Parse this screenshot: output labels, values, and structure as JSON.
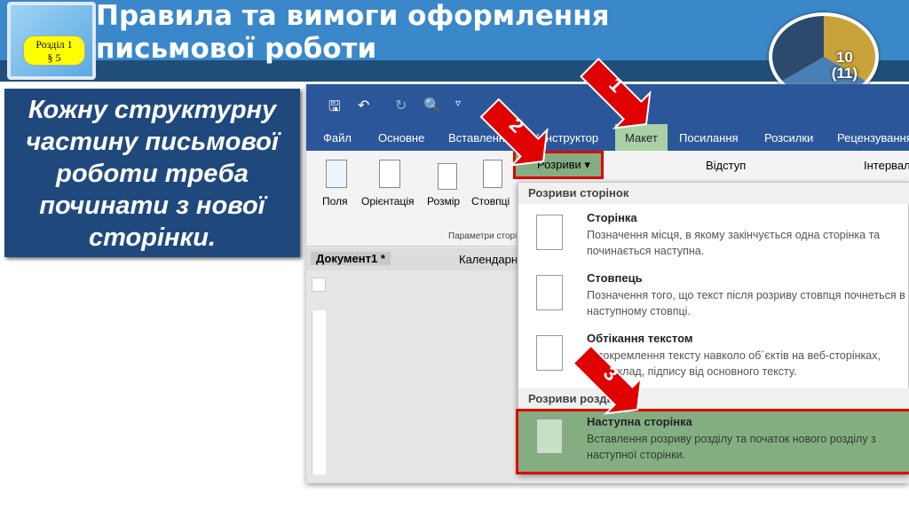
{
  "slide": {
    "title_line1": "Правила та вимоги оформлення",
    "title_line2": "письмової роботи",
    "badge_line1": "Розділ 1",
    "badge_line2": "§ 5",
    "grade": "10\n(11)",
    "note": "Кожну структурну частину письмової роботи треба починати з нової сторінки."
  },
  "word": {
    "qat": {
      "save": "🖫",
      "undo": "↶",
      "redo": "↻",
      "preview": "🔍",
      "more": "▿"
    },
    "tabs": [
      "Файл",
      "Основне",
      "Вставлення",
      "Конструктор",
      "Макет",
      "Посилання",
      "Розсилки",
      "Рецензування"
    ],
    "ribbon": {
      "fields": "Поля",
      "orientation": "Орієнтація",
      "size": "Розмір",
      "columns": "Стовпці",
      "breaks": "Розриви",
      "indent": "Відступ",
      "spacing": "Інтервал",
      "group": "Параметри сторінки"
    },
    "doc_tabs": [
      "Документ1 *",
      "Календарний"
    ],
    "menu": {
      "page_breaks": "Розриви сторінок",
      "items": [
        {
          "title": "Сторінка",
          "desc": "Позначення місця, в якому закінчується одна сторінка та починається наступна."
        },
        {
          "title": "Стовпець",
          "desc": "Позначення того, що текст після розриву стовпця почнеться в наступному стовпці."
        },
        {
          "title": "Обтікання текстом",
          "desc": "Відокремлення тексту навколо об´єктів на веб-сторінках, наприклад, підпису від основного тексту."
        }
      ],
      "section_breaks": "Розриви розділів",
      "section_items": [
        {
          "title": "Наступна сторінка",
          "desc": "Вставлення розриву розділу та початок нового розділу з наступної сторінки."
        }
      ]
    }
  },
  "arrows": [
    "1",
    "2",
    "3"
  ],
  "colors": {
    "header": "#3a88c9",
    "dark": "#1f4e79",
    "word": "#2b579a",
    "highlight": "#84ae81",
    "arrow": "#e00000"
  }
}
